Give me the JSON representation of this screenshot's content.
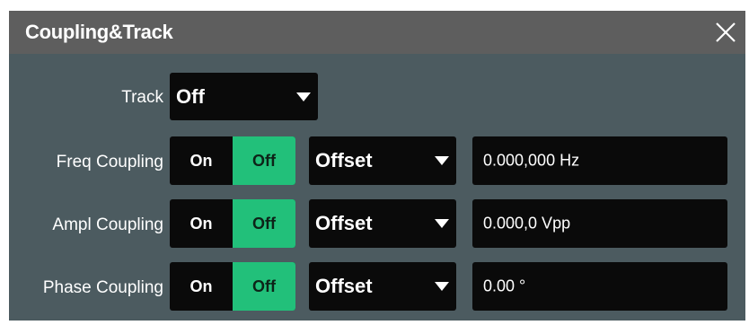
{
  "dialog": {
    "title": "Coupling&Track",
    "close_icon": "close-icon"
  },
  "track": {
    "label": "Track",
    "value": "Off"
  },
  "rows": [
    {
      "label": "Freq Coupling",
      "toggle_on": "On",
      "toggle_off": "Off",
      "selected": "Off",
      "mode": "Offset",
      "value": "0.000,000 Hz"
    },
    {
      "label": "Ampl Coupling",
      "toggle_on": "On",
      "toggle_off": "Off",
      "selected": "Off",
      "mode": "Offset",
      "value": "0.000,0 Vpp"
    },
    {
      "label": "Phase Coupling",
      "toggle_on": "On",
      "toggle_off": "Off",
      "selected": "Off",
      "mode": "Offset",
      "value": "0.00 °"
    }
  ],
  "colors": {
    "background": "#4c5b60",
    "title_bar": "#5e5e5e",
    "control": "#0a0a0a",
    "active_toggle": "#22c07a"
  }
}
